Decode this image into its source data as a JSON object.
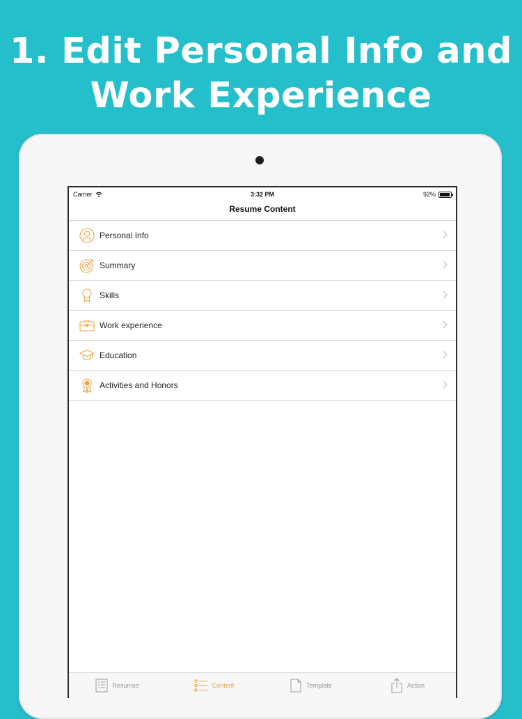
{
  "promo": {
    "line1": "1. Edit Personal Info and",
    "line2": "Work Experience"
  },
  "status_bar": {
    "carrier": "Carrier",
    "time": "3:32 PM",
    "battery_text": "92%"
  },
  "nav": {
    "title": "Resume Content"
  },
  "rows": [
    {
      "label": "Personal Info",
      "icon": "person-circle-icon"
    },
    {
      "label": "Summary",
      "icon": "target-icon"
    },
    {
      "label": "Skills",
      "icon": "award-ribbon-icon"
    },
    {
      "label": "Work experience",
      "icon": "briefcase-icon"
    },
    {
      "label": "Education",
      "icon": "graduation-cap-icon"
    },
    {
      "label": "Activities and Honors",
      "icon": "medal-icon"
    }
  ],
  "tabs": [
    {
      "label": "Resumes",
      "icon": "document-list-icon",
      "active": false
    },
    {
      "label": "Content",
      "icon": "list-icon",
      "active": true
    },
    {
      "label": "Template",
      "icon": "page-icon",
      "active": false
    },
    {
      "label": "Action",
      "icon": "share-icon",
      "active": false
    }
  ],
  "colors": {
    "background": "#25bfcb",
    "accent": "#f0a548",
    "tab_inactive": "#9a9a9a"
  }
}
